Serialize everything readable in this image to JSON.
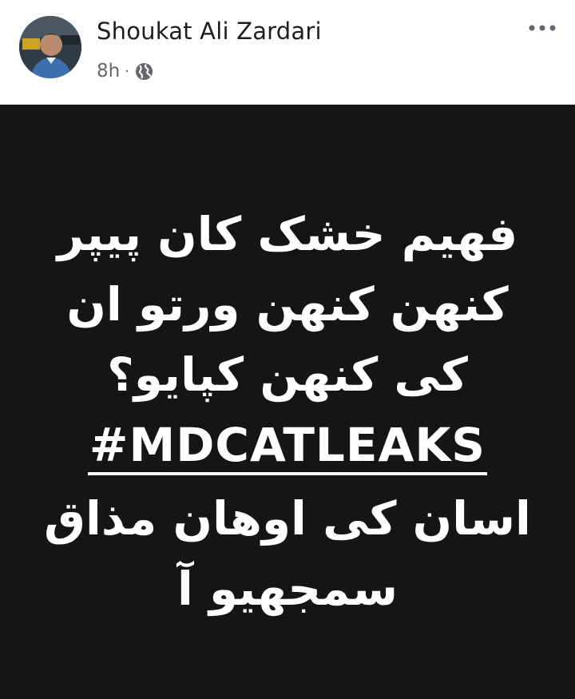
{
  "post": {
    "author_name": "Shoukat Ali Zardari",
    "time": "8h",
    "separator": "·",
    "privacy_icon": "globe-icon",
    "more_icon": "more-options-icon",
    "body_lines": [
      "فھیم خشک کان پیپر",
      "کنھن کنھن ورتو ان",
      "کی کنھن کپایو؟",
      "اسان کی اوھان مذاق",
      "سمجھیو آ"
    ],
    "hashtag": "#MDCATLEAKS"
  },
  "colors": {
    "body_background": "#151515",
    "body_text": "#ffffff",
    "name_text": "#1c1e21",
    "meta_text": "#65676b"
  }
}
